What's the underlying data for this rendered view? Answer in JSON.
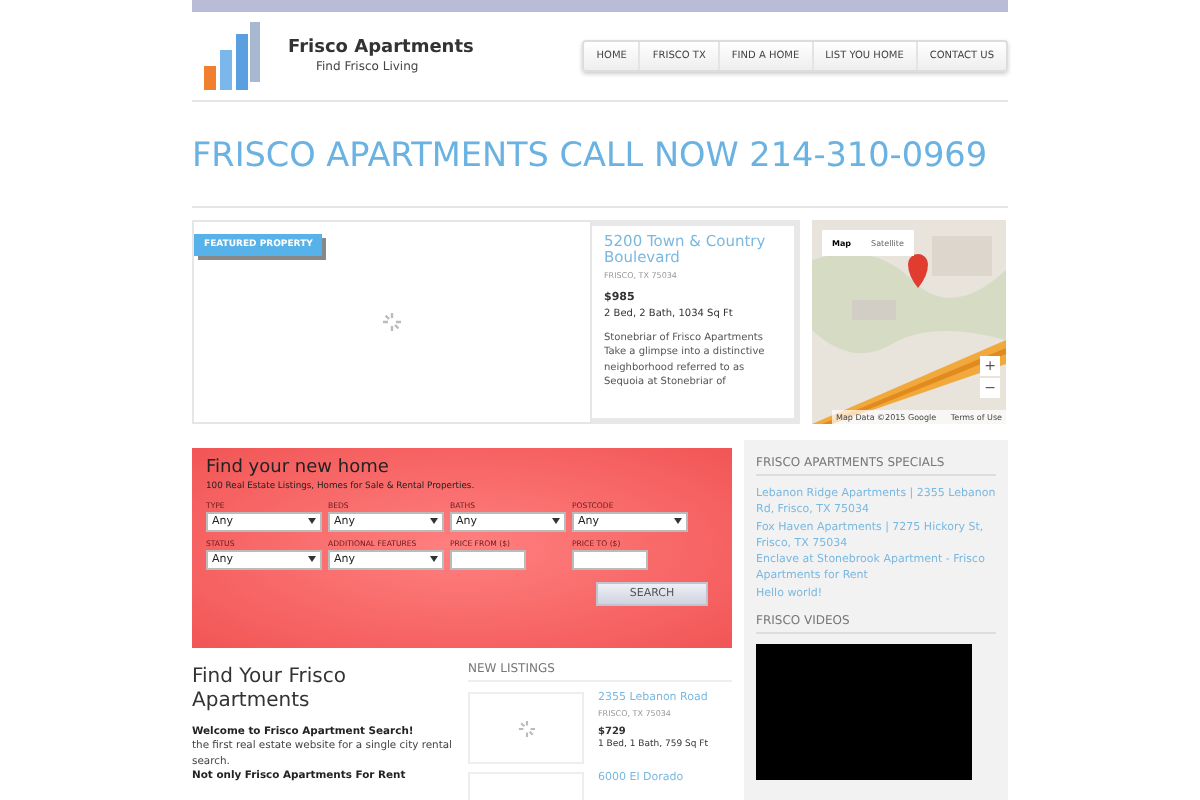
{
  "logo": {
    "title": "Frisco Apartments",
    "tagline": "Find Frisco Living"
  },
  "nav": [
    "HOME",
    "FRISCO TX",
    "FIND A HOME",
    "LIST YOU HOME",
    "CONTACT US"
  ],
  "headline": "FRISCO APARTMENTS CALL NOW 214-310-0969",
  "featured": {
    "badge": "FEATURED PROPERTY",
    "title": "5200 Town & Country Boulevard",
    "location": "FRISCO, TX 75034",
    "price": "$985",
    "details": "2 Bed, 2 Bath, 1034 Sq Ft",
    "description": "Stonebriar of Frisco Apartments Take a glimpse into a distinctive neighborhood referred to as Sequoia at Stonebriar of"
  },
  "map": {
    "tabs": [
      {
        "label": "Map",
        "selected": true
      },
      {
        "label": "Satellite",
        "selected": false
      }
    ],
    "zoom_in": "+",
    "zoom_out": "−",
    "attribution": "Map Data ©2015 Google",
    "terms": "Terms of Use"
  },
  "search": {
    "title": "Find your new home",
    "subtitle": "100 Real Estate Listings, Homes for Sale & Rental Properties.",
    "fields": [
      {
        "kind": "select",
        "label": "TYPE",
        "value": "Any"
      },
      {
        "kind": "select",
        "label": "BEDS",
        "value": "Any"
      },
      {
        "kind": "select",
        "label": "BATHS",
        "value": "Any"
      },
      {
        "kind": "select",
        "label": "POSTCODE",
        "value": "Any"
      },
      {
        "kind": "select",
        "label": "STATUS",
        "value": "Any"
      },
      {
        "kind": "select",
        "label": "ADDITIONAL FEATURES",
        "value": "Any"
      },
      {
        "kind": "text",
        "label": "PRICE FROM ($)"
      },
      {
        "kind": "text",
        "label": "PRICE TO ($)"
      }
    ],
    "button": "SEARCH"
  },
  "intro": {
    "title": "Find Your Frisco Apartments",
    "lines": [
      {
        "text": "Welcome to Frisco Apartment Search!",
        "bold": true
      },
      {
        "text": "the first real estate website for a single city rental search.",
        "bold": false
      },
      {
        "text": "Not only Frisco Apartments For Rent",
        "bold": true
      }
    ]
  },
  "new_listings": {
    "title": "NEW LISTINGS",
    "items": [
      {
        "title": "2355 Lebanon Road",
        "location": "FRISCO, TX 75034",
        "price": "$729",
        "details": "1 Bed, 1 Bath, 759 Sq Ft"
      },
      {
        "title": "6000 El Dorado"
      }
    ]
  },
  "sidebar": {
    "specials_title": "FRISCO APARTMENTS SPECIALS",
    "links": [
      "Lebanon Ridge Apartments | 2355 Lebanon Rd, Frisco, TX 75034",
      "Fox Haven Apartments | 7275 Hickory St, Frisco, TX 75034",
      "Enclave at Stonebrook Apartment - Frisco Apartments for Rent",
      "Hello world!"
    ],
    "videos_title": "FRISCO VIDEOS"
  }
}
